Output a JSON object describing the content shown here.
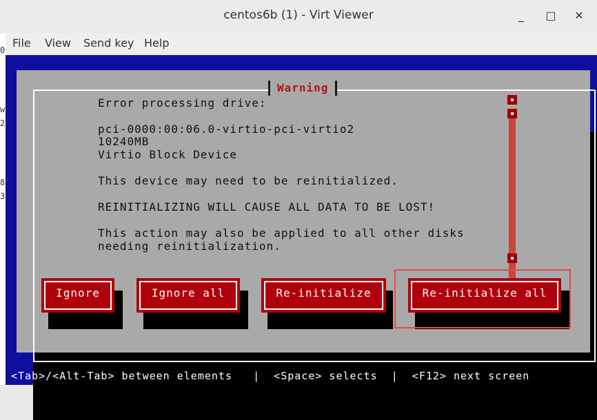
{
  "window": {
    "title": "centos6b (1) - Virt Viewer",
    "minimize_glyph": "_",
    "maximize_glyph": "□",
    "close_glyph": "✕"
  },
  "menu": {
    "items": [
      "File",
      "View",
      "Send key",
      "Help"
    ]
  },
  "left_strip": [
    "0",
    "w",
    "2",
    "8",
    "3"
  ],
  "dialog": {
    "title": "Warning",
    "lines": [
      "Error processing drive:",
      "pci-0000:00:06.0-virtio-pci-virtio2",
      "10240MB",
      "Virtio Block Device",
      "This device may need to be reinitialized.",
      "REINITIALIZING WILL CAUSE ALL DATA TO BE LOST!",
      "This action may also be applied to all other disks",
      "needing reinitialization."
    ],
    "buttons": [
      "Ignore",
      "Ignore all",
      "Re-initialize",
      "Re-initialize all"
    ]
  },
  "statusbar": {
    "text": "<Tab>/<Alt-Tab> between elements   |  <Space> selects  |  <F12> next screen"
  },
  "colors": {
    "background_blue": "#0f0f9e",
    "dialog_gray": "#a9a9a9",
    "button_red": "#b0000b",
    "title_red": "#b01414",
    "highlight": "#e8474d"
  }
}
